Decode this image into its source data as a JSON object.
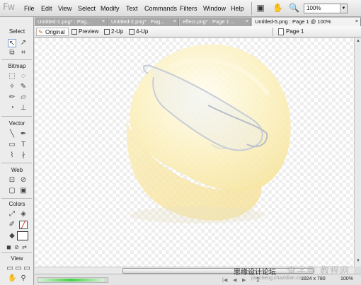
{
  "app": {
    "logo": "Fw"
  },
  "menu": {
    "items": [
      "File",
      "Edit",
      "View",
      "Select",
      "Modify",
      "Text",
      "Commands",
      "Filters",
      "Window",
      "Help"
    ]
  },
  "toolbar": {
    "zoom": "100%"
  },
  "tools": {
    "sections": [
      "Select",
      "Bitmap",
      "Vector",
      "Web",
      "Colors",
      "View"
    ]
  },
  "doc_tabs": [
    {
      "label": "Untitled-1.png* : Pag..."
    },
    {
      "label": "Untitled-2.png* : Pag..."
    },
    {
      "label": "effect.png* : Page 1 ..."
    },
    {
      "label": "Untitled-5.png : Page 1 @ 100%"
    }
  ],
  "view_tabs": {
    "original": "Original",
    "preview": "Preview",
    "two_up": "2-Up",
    "four_up": "4-Up",
    "page": "Page 1"
  },
  "status": {
    "page_num": "1",
    "size": "1024 x 780",
    "zoom": "100%",
    "progress": 0.95
  },
  "watermark": {
    "cn": "思缘设计论坛",
    "site": "查字典 教程网",
    "url": "jiaocheng.chazidian.com"
  },
  "colors": {
    "accent": "#3d7fd6",
    "helmet": "#fcf0b6"
  }
}
